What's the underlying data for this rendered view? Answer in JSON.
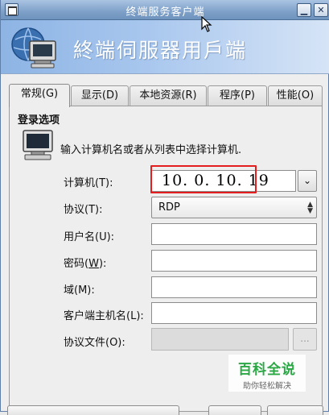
{
  "window": {
    "title": "终端服务客户端",
    "minimize_glyph": "▁",
    "close_glyph": "✕"
  },
  "banner": {
    "title": "終端伺服器用戶端",
    "icon": "computer-globe-icon"
  },
  "tabs": [
    {
      "label": "常规(G)",
      "active": true
    },
    {
      "label": "显示(D)",
      "active": false
    },
    {
      "label": "本地资源(R)",
      "active": false
    },
    {
      "label": "程序(P)",
      "active": false
    },
    {
      "label": "性能(O)",
      "active": false
    }
  ],
  "login": {
    "section_title": "登录选项",
    "instruction": "输入计算机名或者从列表中选择计算机.",
    "computer_label": "计算机(T):",
    "computer_value": "10. 0. 10. 19",
    "protocol_label": "协议(T):",
    "protocol_value": "RDP",
    "username_label": "用户名(U):",
    "username_value": "",
    "password_label_prefix": "密码(",
    "password_label_key": "W",
    "password_label_suffix": "):",
    "password_value": "",
    "domain_label": "域(M):",
    "domain_value": "",
    "client_host_label": "客户端主机名(L):",
    "client_host_value": "",
    "protocol_file_label": "协议文件(O):",
    "protocol_file_value": "",
    "browse_label": "..."
  },
  "watermark": {
    "main": "百科全说",
    "sub": "助你轻松解决"
  },
  "colors": {
    "highlight": "#e41e1e",
    "banner_start": "#8db4e4",
    "titlebar": "#7ea0c8",
    "watermark_green": "#29a844"
  }
}
